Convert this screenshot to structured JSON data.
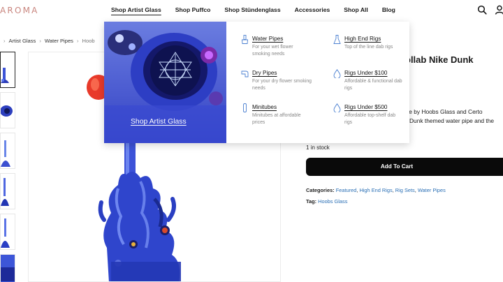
{
  "header": {
    "logo": "AROMA",
    "nav": [
      {
        "label": "Shop Artist Glass"
      },
      {
        "label": "Shop Puffco"
      },
      {
        "label": "Shop Stündenglass"
      },
      {
        "label": "Accessories"
      },
      {
        "label": "Shop All"
      },
      {
        "label": "Blog"
      }
    ],
    "icons": [
      "search-icon",
      "user-icon"
    ]
  },
  "breadcrumb": {
    "sep": "›",
    "items": [
      "Artist Glass",
      "Water Pipes",
      "Hoob"
    ]
  },
  "mega_menu": {
    "feature_caption": "Shop Artist Glass",
    "items": [
      {
        "title": "Water Pipes",
        "desc": "For your wet flower smoking needs",
        "icon": "water-pipe-icon"
      },
      {
        "title": "High End Rigs",
        "desc": "Top of the line dab rigs",
        "icon": "rig-icon"
      },
      {
        "title": "Dry Pipes",
        "desc": "For your dry flower smoking needs",
        "icon": "dry-pipe-icon"
      },
      {
        "title": "Rigs Under $100",
        "desc": "Affordable & functional dab rigs",
        "icon": "droplet-icon"
      },
      {
        "title": "Minitubes",
        "desc": "Minitubes at affordable prices",
        "icon": "minitube-icon"
      },
      {
        "title": "Rigs Under $500",
        "desc": "Affordable top-shelf dab rigs",
        "icon": "droplet-icon"
      }
    ]
  },
  "product": {
    "title_fragment": "ollab Nike Dunk",
    "desc_line1": "made by Hoobs Glass and Certo",
    "desc_line2": "Dunk themed water pipe and the",
    "stock": "1 in stock",
    "cart_label": "Add To Cart",
    "categories_label": "Categories:",
    "categories": [
      "Featured",
      "High End Rigs",
      "Rig Sets",
      "Water Pipes"
    ],
    "tag_label": "Tag:",
    "tags": [
      "Hoobs Glass"
    ]
  }
}
